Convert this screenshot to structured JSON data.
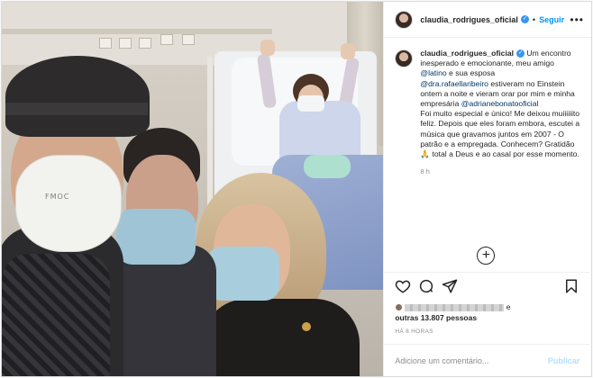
{
  "header": {
    "username": "claudia_rodrigues_oficial",
    "separator": "•",
    "follow_label": "Seguir",
    "more_icon": "more-horizontal-icon"
  },
  "caption": {
    "username": "claudia_rodrigues_oficial",
    "text_1": " Um encontro inesperado e emocionante, meu amigo ",
    "mention_1": "@latino",
    "text_2": " e sua esposa ",
    "mention_2": "@dra.rafaellaribeiro",
    "text_3": " estiveram no Einstein ontem a noite e vieram orar por mim e minha empresária ",
    "mention_3": "@adrianebonatooficial",
    "text_4": "Foi muito especial e único! Me deixou muiiiiiito feliz. Depois que eles foram embora, escutei a música que gravamos juntos em 2007 - O patrão e a empregada. Conhecem? Gratidão",
    "emoji": "🙏",
    "text_5": " total a Deus e ao casal por esse momento.",
    "time": "8 h"
  },
  "photo": {
    "mask_text": "FMOC"
  },
  "actions": {
    "like_icon": "heart-icon",
    "comment_icon": "comment-icon",
    "share_icon": "share-icon",
    "save_icon": "bookmark-icon",
    "load_more_icon": "plus-circle-icon"
  },
  "likes": {
    "suffix": "e",
    "count_text": "outras 13.807 pessoas"
  },
  "posted": "HÁ 8 HORAS",
  "comment_box": {
    "placeholder": "Adicione um comentário...",
    "publish_label": "Publicar"
  },
  "colors": {
    "accent": "#0095f6",
    "verified": "#3897f0",
    "mention": "#00376b",
    "muted": "#8e8e8e",
    "publish_disabled": "#b2dffc"
  }
}
